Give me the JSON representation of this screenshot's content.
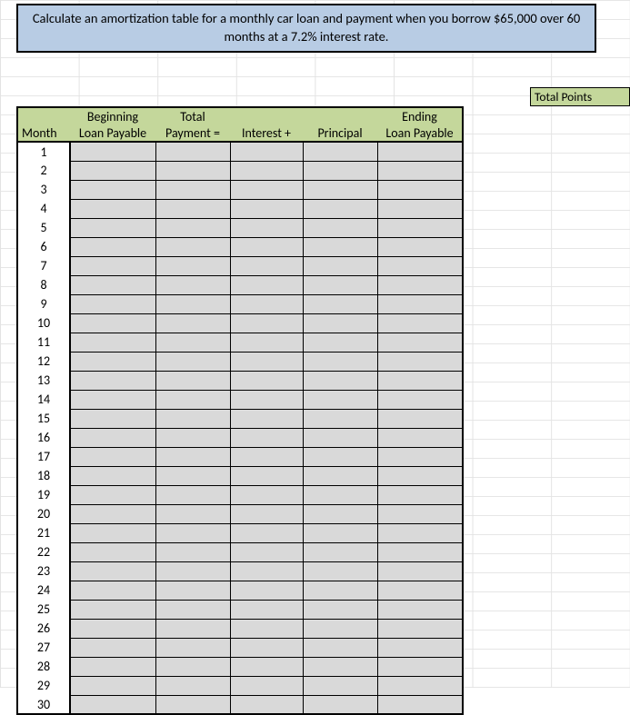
{
  "banner": {
    "text": "Calculate an amortization table for a monthly car loan and payment when you borrow $65,000 over 60 months at a 7.2% interest rate."
  },
  "side": {
    "total_points_label": "Total Points"
  },
  "table": {
    "headers": {
      "month": "Month",
      "beginning_top": "Beginning",
      "beginning_bot": "Loan Payable",
      "total_top": "Total",
      "total_bot": "Payment  =",
      "interest": "Interest   +",
      "principal": "Principal",
      "ending_top": "Ending",
      "ending_bot": "Loan Payable"
    },
    "rows": [
      {
        "month": "1",
        "beginning": "",
        "payment": "",
        "interest": "",
        "principal": "",
        "ending": ""
      },
      {
        "month": "2",
        "beginning": "",
        "payment": "",
        "interest": "",
        "principal": "",
        "ending": ""
      },
      {
        "month": "3",
        "beginning": "",
        "payment": "",
        "interest": "",
        "principal": "",
        "ending": ""
      },
      {
        "month": "4",
        "beginning": "",
        "payment": "",
        "interest": "",
        "principal": "",
        "ending": ""
      },
      {
        "month": "5",
        "beginning": "",
        "payment": "",
        "interest": "",
        "principal": "",
        "ending": ""
      },
      {
        "month": "6",
        "beginning": "",
        "payment": "",
        "interest": "",
        "principal": "",
        "ending": ""
      },
      {
        "month": "7",
        "beginning": "",
        "payment": "",
        "interest": "",
        "principal": "",
        "ending": ""
      },
      {
        "month": "8",
        "beginning": "",
        "payment": "",
        "interest": "",
        "principal": "",
        "ending": ""
      },
      {
        "month": "9",
        "beginning": "",
        "payment": "",
        "interest": "",
        "principal": "",
        "ending": ""
      },
      {
        "month": "10",
        "beginning": "",
        "payment": "",
        "interest": "",
        "principal": "",
        "ending": ""
      },
      {
        "month": "11",
        "beginning": "",
        "payment": "",
        "interest": "",
        "principal": "",
        "ending": ""
      },
      {
        "month": "12",
        "beginning": "",
        "payment": "",
        "interest": "",
        "principal": "",
        "ending": ""
      },
      {
        "month": "13",
        "beginning": "",
        "payment": "",
        "interest": "",
        "principal": "",
        "ending": ""
      },
      {
        "month": "14",
        "beginning": "",
        "payment": "",
        "interest": "",
        "principal": "",
        "ending": ""
      },
      {
        "month": "15",
        "beginning": "",
        "payment": "",
        "interest": "",
        "principal": "",
        "ending": ""
      },
      {
        "month": "16",
        "beginning": "",
        "payment": "",
        "interest": "",
        "principal": "",
        "ending": ""
      },
      {
        "month": "17",
        "beginning": "",
        "payment": "",
        "interest": "",
        "principal": "",
        "ending": ""
      },
      {
        "month": "18",
        "beginning": "",
        "payment": "",
        "interest": "",
        "principal": "",
        "ending": ""
      },
      {
        "month": "19",
        "beginning": "",
        "payment": "",
        "interest": "",
        "principal": "",
        "ending": ""
      },
      {
        "month": "20",
        "beginning": "",
        "payment": "",
        "interest": "",
        "principal": "",
        "ending": ""
      },
      {
        "month": "21",
        "beginning": "",
        "payment": "",
        "interest": "",
        "principal": "",
        "ending": ""
      },
      {
        "month": "22",
        "beginning": "",
        "payment": "",
        "interest": "",
        "principal": "",
        "ending": ""
      },
      {
        "month": "23",
        "beginning": "",
        "payment": "",
        "interest": "",
        "principal": "",
        "ending": ""
      },
      {
        "month": "24",
        "beginning": "",
        "payment": "",
        "interest": "",
        "principal": "",
        "ending": ""
      },
      {
        "month": "25",
        "beginning": "",
        "payment": "",
        "interest": "",
        "principal": "",
        "ending": ""
      },
      {
        "month": "26",
        "beginning": "",
        "payment": "",
        "interest": "",
        "principal": "",
        "ending": ""
      },
      {
        "month": "27",
        "beginning": "",
        "payment": "",
        "interest": "",
        "principal": "",
        "ending": ""
      },
      {
        "month": "28",
        "beginning": "",
        "payment": "",
        "interest": "",
        "principal": "",
        "ending": ""
      },
      {
        "month": "29",
        "beginning": "",
        "payment": "",
        "interest": "",
        "principal": "",
        "ending": ""
      },
      {
        "month": "30",
        "beginning": "",
        "payment": "",
        "interest": "",
        "principal": "",
        "ending": ""
      }
    ]
  }
}
